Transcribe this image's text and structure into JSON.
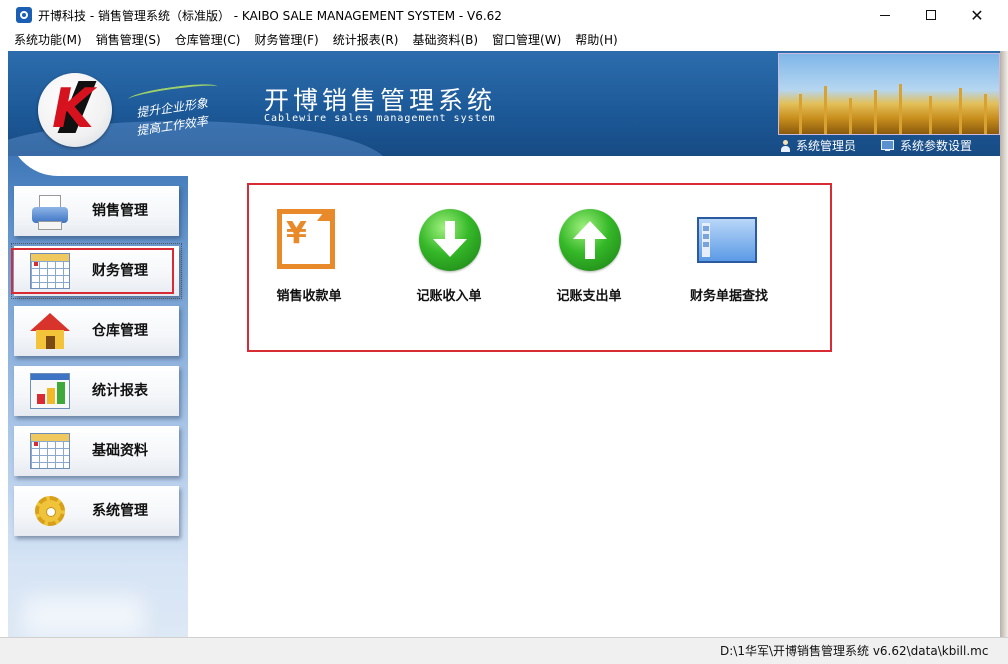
{
  "window": {
    "title": "开博科技 - 销售管理系统（标准版）          - KAIBO SALE MANAGEMENT SYSTEM - V6.62"
  },
  "menu": [
    {
      "label": "系统功能(M)"
    },
    {
      "label": "销售管理(S)"
    },
    {
      "label": "仓库管理(C)"
    },
    {
      "label": "财务管理(F)"
    },
    {
      "label": "统计报表(R)"
    },
    {
      "label": "基础资料(B)"
    },
    {
      "label": "窗口管理(W)"
    },
    {
      "label": "帮助(H)"
    }
  ],
  "banner": {
    "slogan1": "提升企业形象",
    "slogan2": "提高工作效率",
    "title": "开博销售管理系统",
    "subtitle": "Cablewire sales management system",
    "user_link": "系统管理员",
    "settings_link": "系统参数设置"
  },
  "sidebar": {
    "items": [
      {
        "label": "销售管理",
        "icon": "printer-icon"
      },
      {
        "label": "财务管理",
        "icon": "spreadsheet-icon",
        "active": true
      },
      {
        "label": "仓库管理",
        "icon": "house-icon"
      },
      {
        "label": "统计报表",
        "icon": "bar-chart-icon"
      },
      {
        "label": "基础资料",
        "icon": "spreadsheet-icon"
      },
      {
        "label": "系统管理",
        "icon": "gear-icon"
      }
    ]
  },
  "main": {
    "tiles": [
      {
        "label": "销售收款单",
        "icon": "yen-receipt-icon"
      },
      {
        "label": "记账收入单",
        "icon": "arrow-down-icon"
      },
      {
        "label": "记账支出单",
        "icon": "arrow-up-icon"
      },
      {
        "label": "财务单据查找",
        "icon": "window-icon"
      }
    ]
  },
  "status": {
    "path": "D:\\1华军\\开博销售管理系统 v6.62\\data\\kbill.mc"
  },
  "colors": {
    "banner_blue": "#1d5a99",
    "highlight_red": "#d92b34",
    "icon_green": "#35b828",
    "icon_orange": "#e98a2a"
  }
}
